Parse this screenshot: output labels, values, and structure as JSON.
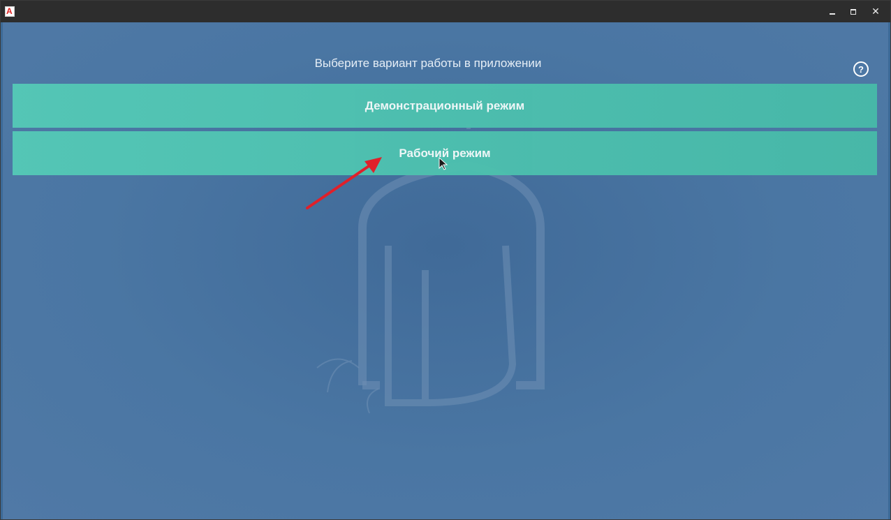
{
  "window": {
    "app_icon_letter": "A",
    "controls": {
      "minimize": "minimize",
      "maximize": "maximize",
      "close": "✕"
    }
  },
  "main": {
    "title": "Выберите вариант работы в приложении",
    "help_label": "?",
    "buttons": [
      {
        "label": "Демонстрационный режим"
      },
      {
        "label": "Рабочий режим"
      }
    ]
  },
  "icons": {
    "app": "app-logo-icon",
    "help": "question-circle-icon",
    "annotation": "red-arrow-icon",
    "cursor": "mouse-pointer-icon",
    "watermark": "bottle-watermark-icon"
  },
  "colors": {
    "titlebar": "#2d2d2d",
    "background": "#4a76a3",
    "button": "#4ebfae",
    "button_text": "#f4fbfa",
    "arrow": "#e0202a"
  }
}
